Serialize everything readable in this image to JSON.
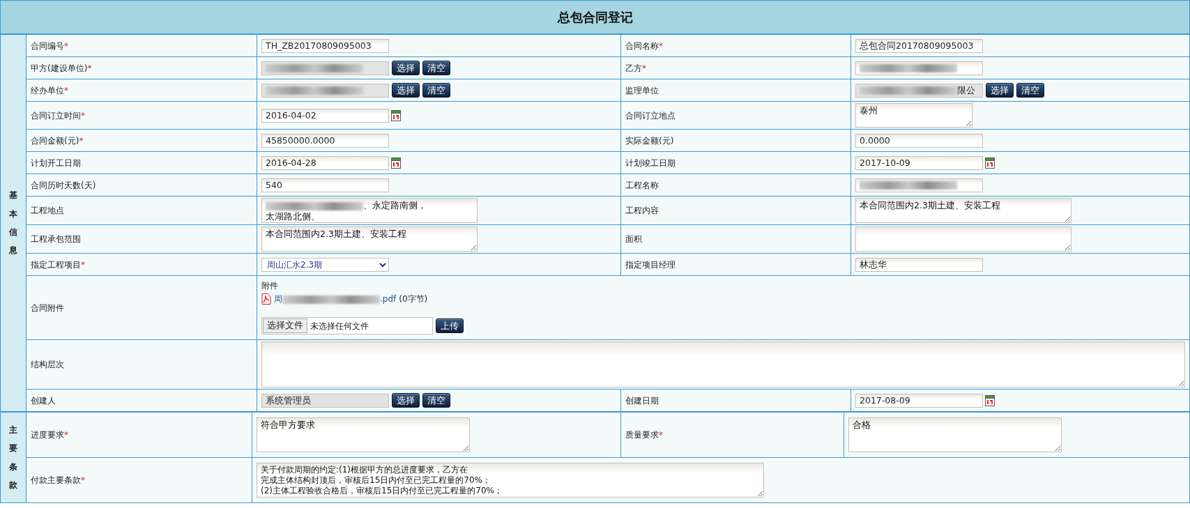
{
  "title": "总包合同登记",
  "sections": [
    {
      "heading": "基本信息",
      "rows": [
        {
          "cells": [
            {
              "label": "合同编号",
              "mark": "*",
              "field": {
                "kind": "text",
                "value": "TH_ZB20170809095003"
              }
            },
            {
              "label": "合同名称",
              "mark": "*",
              "field": {
                "kind": "text",
                "value": "总包合同20170809095003"
              }
            }
          ]
        },
        {
          "cells": [
            {
              "label": "甲方(建设单位)",
              "mark": "*",
              "field": {
                "kind": "picker",
                "redacted": true,
                "buttons": [
                  "选择",
                  "清空"
                ]
              }
            },
            {
              "label": "乙方",
              "mark": "*",
              "field": {
                "kind": "text",
                "redacted": true
              }
            }
          ]
        },
        {
          "cells": [
            {
              "label": "经办单位",
              "mark": "*",
              "field": {
                "kind": "picker",
                "redacted": true,
                "buttons": [
                  "选择",
                  "清空"
                ]
              }
            },
            {
              "label": "监理单位",
              "field": {
                "kind": "picker",
                "redacted": true,
                "value": "限公",
                "buttons": [
                  "选择",
                  "清空"
                ]
              }
            }
          ]
        },
        {
          "cells": [
            {
              "label": "合同订立时间",
              "mark": "*",
              "field": {
                "kind": "date",
                "value": "2016-04-02"
              }
            },
            {
              "label": "合同订立地点",
              "field": {
                "kind": "short-textarea",
                "value": "泰州"
              }
            }
          ]
        },
        {
          "cells": [
            {
              "label": "合同金额(元)",
              "mark": "*",
              "field": {
                "kind": "text",
                "value": "45850000.0000"
              }
            },
            {
              "label": "实际金额(元)",
              "field": {
                "kind": "text",
                "value": "0.0000"
              }
            }
          ]
        },
        {
          "cells": [
            {
              "label": "计划开工日期",
              "field": {
                "kind": "date",
                "value": "2016-04-28"
              }
            },
            {
              "label": "计划竣工日期",
              "field": {
                "kind": "date",
                "value": "2017-10-09"
              }
            }
          ]
        },
        {
          "cells": [
            {
              "label": "合同历时天数(天)",
              "field": {
                "kind": "text",
                "value": "540"
              }
            },
            {
              "label": "工程名称",
              "field": {
                "kind": "text",
                "redacted": true
              }
            }
          ]
        },
        {
          "cells": [
            {
              "label": "工程地点",
              "field": {
                "kind": "textarea",
                "redacted": true,
                "lines": [
                  "、永定路南侧，",
                  "太湖路北侧。"
                ]
              }
            },
            {
              "label": "工程内容",
              "field": {
                "kind": "textarea",
                "value": "本合同范围内2.3期土建、安装工程"
              }
            }
          ]
        },
        {
          "cells": [
            {
              "label": "工程承包范围",
              "field": {
                "kind": "textarea",
                "value": "本合同范围内2.3期土建、安装工程"
              }
            },
            {
              "label": "面积",
              "field": {
                "kind": "textarea"
              }
            }
          ]
        },
        {
          "cells": [
            {
              "label": "指定工程项目",
              "mark": "*",
              "field": {
                "kind": "select",
                "value": "周山汇水2.3期"
              }
            },
            {
              "label": "指定项目经理",
              "field": {
                "kind": "text",
                "value": "林志华"
              }
            }
          ]
        },
        {
          "cells": [
            {
              "label": "合同附件",
              "field": {
                "kind": "attachment",
                "redacted": true,
                "caption": "附件",
                "file_lead": "周",
                "file_tail": ".pdf",
                "size": "(0字节)",
                "file_button": "选择文件",
                "file_status": "未选择任何文件",
                "upload": "上传"
              }
            }
          ]
        },
        {
          "cells": [
            {
              "label": "结构层次",
              "field": {
                "kind": "wide-textarea"
              }
            }
          ]
        },
        {
          "cells": [
            {
              "label": "创建人",
              "field": {
                "kind": "picker",
                "value": "系统管理员",
                "buttons": [
                  "选择",
                  "清空"
                ]
              }
            },
            {
              "label": "创建日期",
              "field": {
                "kind": "date",
                "value": "2017-08-09"
              }
            }
          ]
        }
      ]
    },
    {
      "heading": "主要条款",
      "rows": [
        {
          "cells": [
            {
              "label": "进度要求",
              "mark": "*",
              "field": {
                "kind": "textarea",
                "value": "符合甲方要求"
              }
            },
            {
              "label": "质量要求",
              "mark": "*",
              "field": {
                "kind": "textarea",
                "value": "合格"
              }
            }
          ]
        },
        {
          "cells": [
            {
              "label": "付款主要条款",
              "mark": "*",
              "field": {
                "kind": "scroll-textarea",
                "lines": [
                  "关于付款周期的约定:(1)根据甲方的总进度要求，乙方在",
                  "完成主体结构封顶后，审核后15日内付至已完工程量的70%；",
                  "(2)主体工程验收合格后，审核后15日内付至已完工程量的70%；"
                ]
              }
            }
          ]
        }
      ]
    }
  ]
}
